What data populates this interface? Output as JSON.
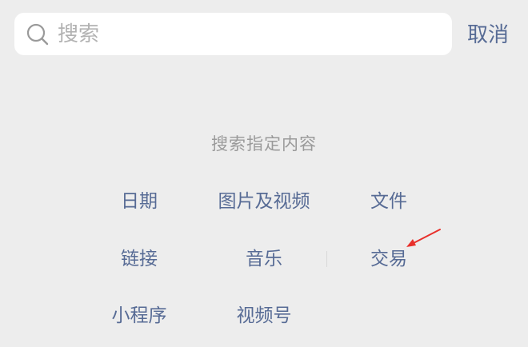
{
  "search": {
    "placeholder": "搜索",
    "cancel_label": "取消"
  },
  "section": {
    "title": "搜索指定内容"
  },
  "categories": [
    "日期",
    "图片及视频",
    "文件",
    "链接",
    "音乐",
    "交易",
    "小程序",
    "视频号"
  ],
  "colors": {
    "background": "#ededed",
    "link": "#576b95",
    "hint": "#9a9a9a",
    "annotation_arrow": "#e8302b"
  },
  "icons": {
    "search": "search-icon",
    "annotation": "red-arrow-icon"
  }
}
